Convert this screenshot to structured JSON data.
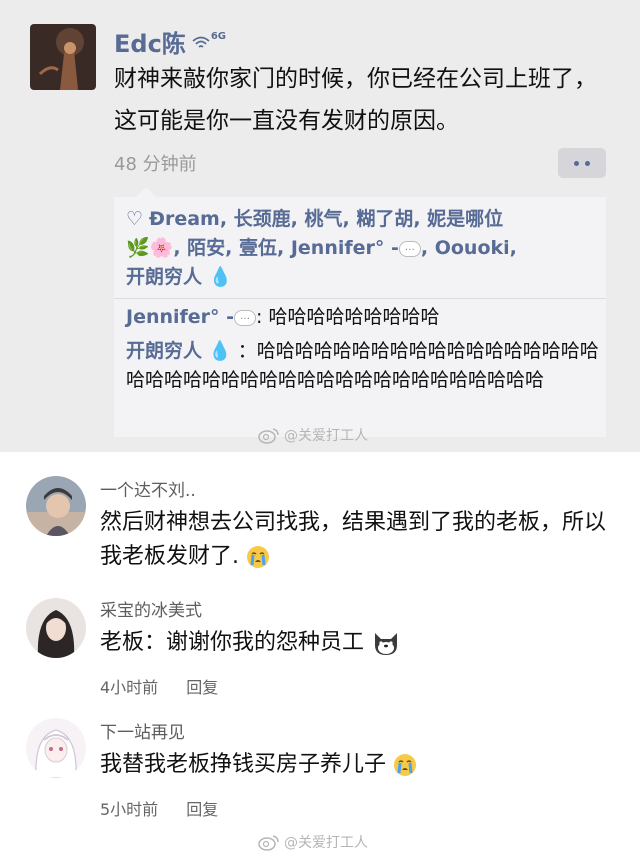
{
  "moments": {
    "poster_name": "Edc陈",
    "poster_signal_label": "6G",
    "post_text": "财神来敲你家门的时候，你已经在公司上班了，这可能是你一直没有发财的原因。",
    "time": "48 分钟前",
    "likes": {
      "names_part1": "Ðream, 长颈鹿, 桃气, 糊了胡, 妮是哪位",
      "names_part2": ", 陌安, 壹伍, Jennifer° -",
      "names_part3": ", Oouoki,",
      "names_part4": "开朗穷人"
    },
    "comments": [
      {
        "user": "Jennifer° -",
        "text": ": 哈哈哈哈哈哈哈哈哈"
      },
      {
        "user": "开朗穷人",
        "text": "：哈哈哈哈哈哈哈哈哈哈哈哈哈哈哈哈哈哈哈哈哈哈哈哈哈哈哈哈哈哈哈哈哈哈哈哈哈哈哈哈"
      }
    ],
    "watermark": "@关爱打工人"
  },
  "comments": [
    {
      "username": "一个达不刘..",
      "text": "然后财神想去公司找我，结果遇到了我的老板，所以我老板发财了.",
      "emoji": "crying-face-icon"
    },
    {
      "username": "采宝的冰美式",
      "text": "老板：谢谢你我的怨种员工",
      "emoji": "doge-icon",
      "time": "4小时前",
      "reply_label": "回复"
    },
    {
      "username": "下一站再见",
      "text": "我替我老板挣钱买房子养儿子",
      "emoji": "crying-face-icon",
      "time": "5小时前",
      "reply_label": "回复"
    }
  ],
  "watermark_bottom": "@关爱打工人",
  "colors": {
    "wechat_link": "#576b95",
    "moments_bg": "#ececec",
    "time_gray": "#9a9a9a"
  }
}
